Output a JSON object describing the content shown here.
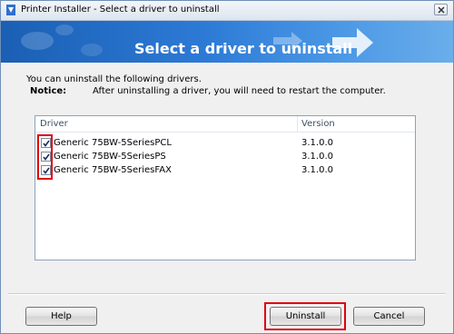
{
  "window": {
    "title": "Printer Installer - Select a driver to uninstall"
  },
  "banner": {
    "title": "Select a driver to uninstall"
  },
  "info": {
    "line1": "You can uninstall the following drivers.",
    "notice_label": "Notice:",
    "notice_text": "After uninstalling a driver, you will need to restart the computer."
  },
  "driver_list": {
    "columns": [
      "Driver",
      "Version"
    ],
    "rows": [
      {
        "name": "Generic 75BW-5SeriesPCL",
        "version": "3.1.0.0",
        "checked": true
      },
      {
        "name": "Generic 75BW-5SeriesPS",
        "version": "3.1.0.0",
        "checked": true
      },
      {
        "name": "Generic 75BW-5SeriesFAX",
        "version": "3.1.0.0",
        "checked": true
      }
    ]
  },
  "buttons": {
    "help": "Help",
    "uninstall": "Uninstall",
    "cancel": "Cancel"
  },
  "icons": {
    "app": "printer-installer-icon",
    "close": "close-icon",
    "checkbox": "checkmark-icon",
    "banner": "arrow-right-icon"
  },
  "colors": {
    "banner_start": "#1a5fb4",
    "banner_end": "#6aaeea",
    "highlight": "#e0000f"
  }
}
